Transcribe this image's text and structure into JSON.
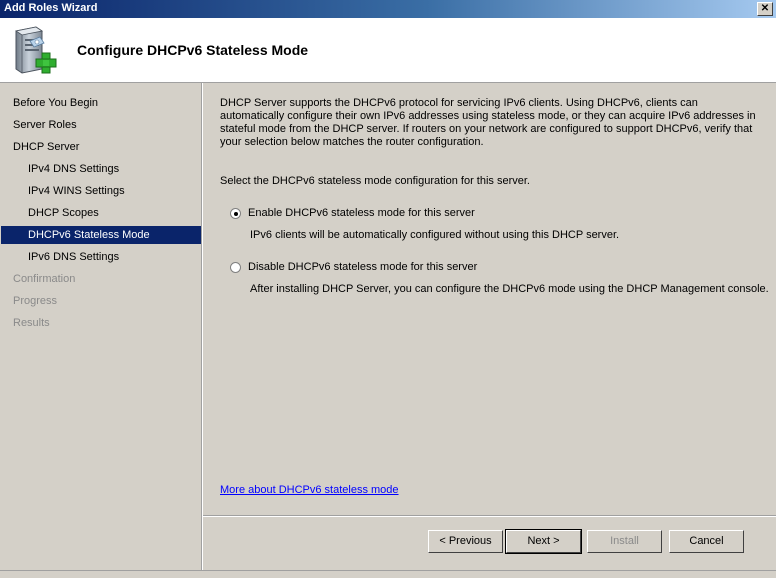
{
  "window": {
    "title": "Add Roles Wizard",
    "close_glyph": "✕"
  },
  "header": {
    "title": "Configure DHCPv6 Stateless Mode",
    "icon": "server-add-icon"
  },
  "nav": {
    "items": [
      {
        "label": "Before You Begin",
        "state": "normal"
      },
      {
        "label": "Server Roles",
        "state": "normal"
      },
      {
        "label": "DHCP Server",
        "state": "normal"
      },
      {
        "label": "IPv4 DNS Settings",
        "state": "normal",
        "sub": true
      },
      {
        "label": "IPv4 WINS Settings",
        "state": "normal",
        "sub": true
      },
      {
        "label": "DHCP Scopes",
        "state": "normal",
        "sub": true
      },
      {
        "label": "DHCPv6 Stateless Mode",
        "state": "active",
        "sub": true
      },
      {
        "label": "IPv6 DNS Settings",
        "state": "normal",
        "sub": true
      },
      {
        "label": "Confirmation",
        "state": "disabled"
      },
      {
        "label": "Progress",
        "state": "disabled"
      },
      {
        "label": "Results",
        "state": "disabled"
      }
    ]
  },
  "content": {
    "intro": "DHCP Server supports the DHCPv6 protocol for servicing IPv6 clients. Using DHCPv6, clients can automatically configure their own IPv6 addresses using stateless mode, or they can acquire IPv6 addresses in stateful mode from the DHCP server. If routers on your network are configured to support DHCPv6, verify that your selection below matches the router configuration.",
    "instruction": "Select the DHCPv6 stateless mode configuration for this server.",
    "options": [
      {
        "label": "Enable DHCPv6 stateless mode for this server",
        "description": "IPv6 clients will be automatically configured without using this DHCP server.",
        "checked": true
      },
      {
        "label": "Disable DHCPv6 stateless mode for this server",
        "description": "After installing DHCP Server, you can configure the DHCPv6 mode using the DHCP Management console.",
        "checked": false
      }
    ],
    "link": "More about DHCPv6 stateless mode"
  },
  "buttons": {
    "previous": "< Previous",
    "next": "Next >",
    "install": "Install",
    "cancel": "Cancel"
  }
}
